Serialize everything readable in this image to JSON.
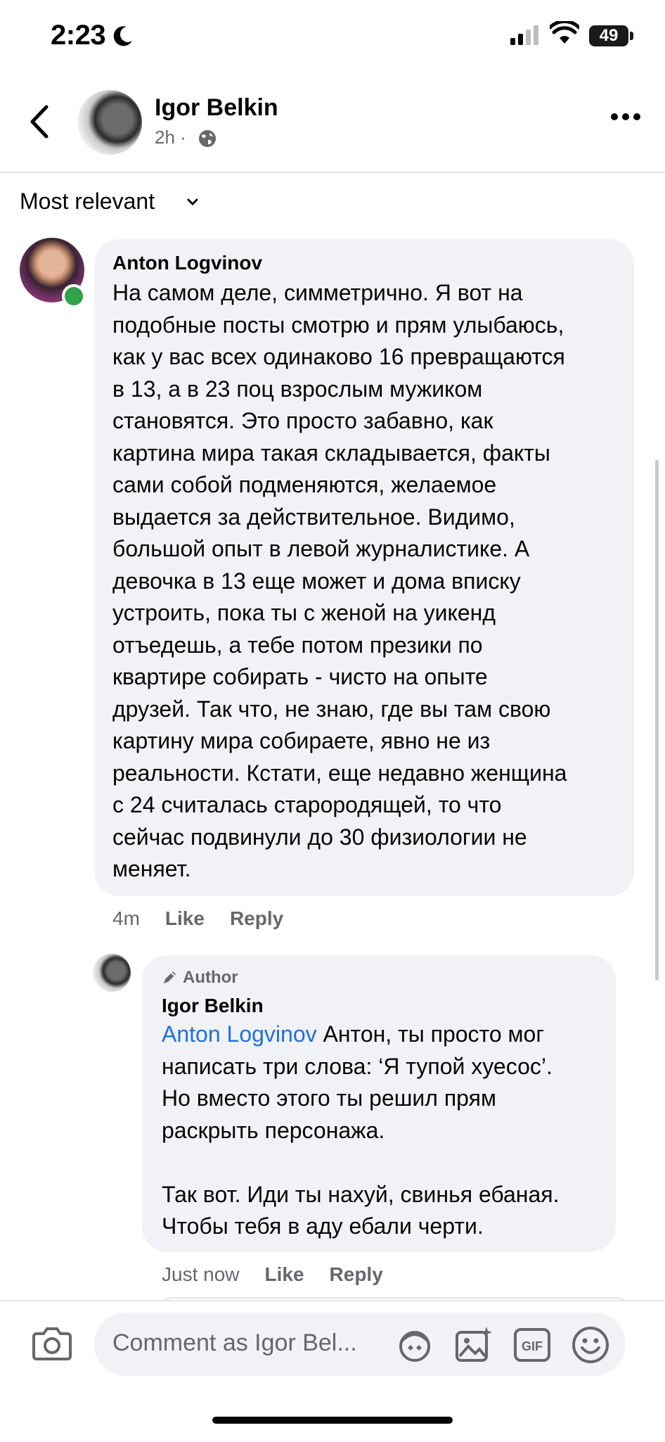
{
  "status_bar": {
    "time": "2:23",
    "battery": "49"
  },
  "header": {
    "name": "Igor Belkin",
    "time_ago": "2h",
    "separator": "·"
  },
  "sort": {
    "label": "Most relevant"
  },
  "comments": [
    {
      "author": "Anton Logvinov",
      "text": "На самом деле, симметрично. Я вот на\nподобные посты смотрю и прям улыбаюсь,\nкак у вас всех одинаково 16 превращаются\nв 13, а в 23 поц взрослым мужиком\nстановятся. Это просто забавно, как\nкартина мира такая складывается, факты\nсами собой подменяются, желаемое\nвыдается за действительное. Видимо,\nбольшой опыт в левой журналистике. А\nдевочка в 13 еще может и дома вписку\nустроить, пока ты с женой на уикенд\nотъедешь, а тебе потом презики по\nквартире собирать - чисто на опыте\nдрузей. Так что, не знаю, где вы там свою\nкартину мира собираете, явно не из\nреальности. Кстати, еще недавно женщина\nс 24 считалась старородящей, то что\nсейчас подвинули до 30 физиологии не\nменяет.",
      "time": "4m",
      "like": "Like",
      "reply": "Reply"
    },
    {
      "badge": "Author",
      "author": "Igor Belkin",
      "mention": "Anton Logvinov",
      "text": " Антон, ты просто мог\nнаписать три слова: ‘Я тупой хуесос’.\nНо вместо этого ты решил прям\nраскрыть персонажа.\n\nТак вот. Иди ты нахуй, свинья ебаная.\nЧтобы тебя в аду ебали черти.",
      "time": "Just now",
      "like": "Like",
      "reply": "Reply"
    }
  ],
  "composer": {
    "placeholder": "Comment as Igor Bel..."
  },
  "colors": {
    "mention": "#216fdb",
    "bubble": "#f0f2f5",
    "online": "#31a24c",
    "muted": "#65676b"
  }
}
